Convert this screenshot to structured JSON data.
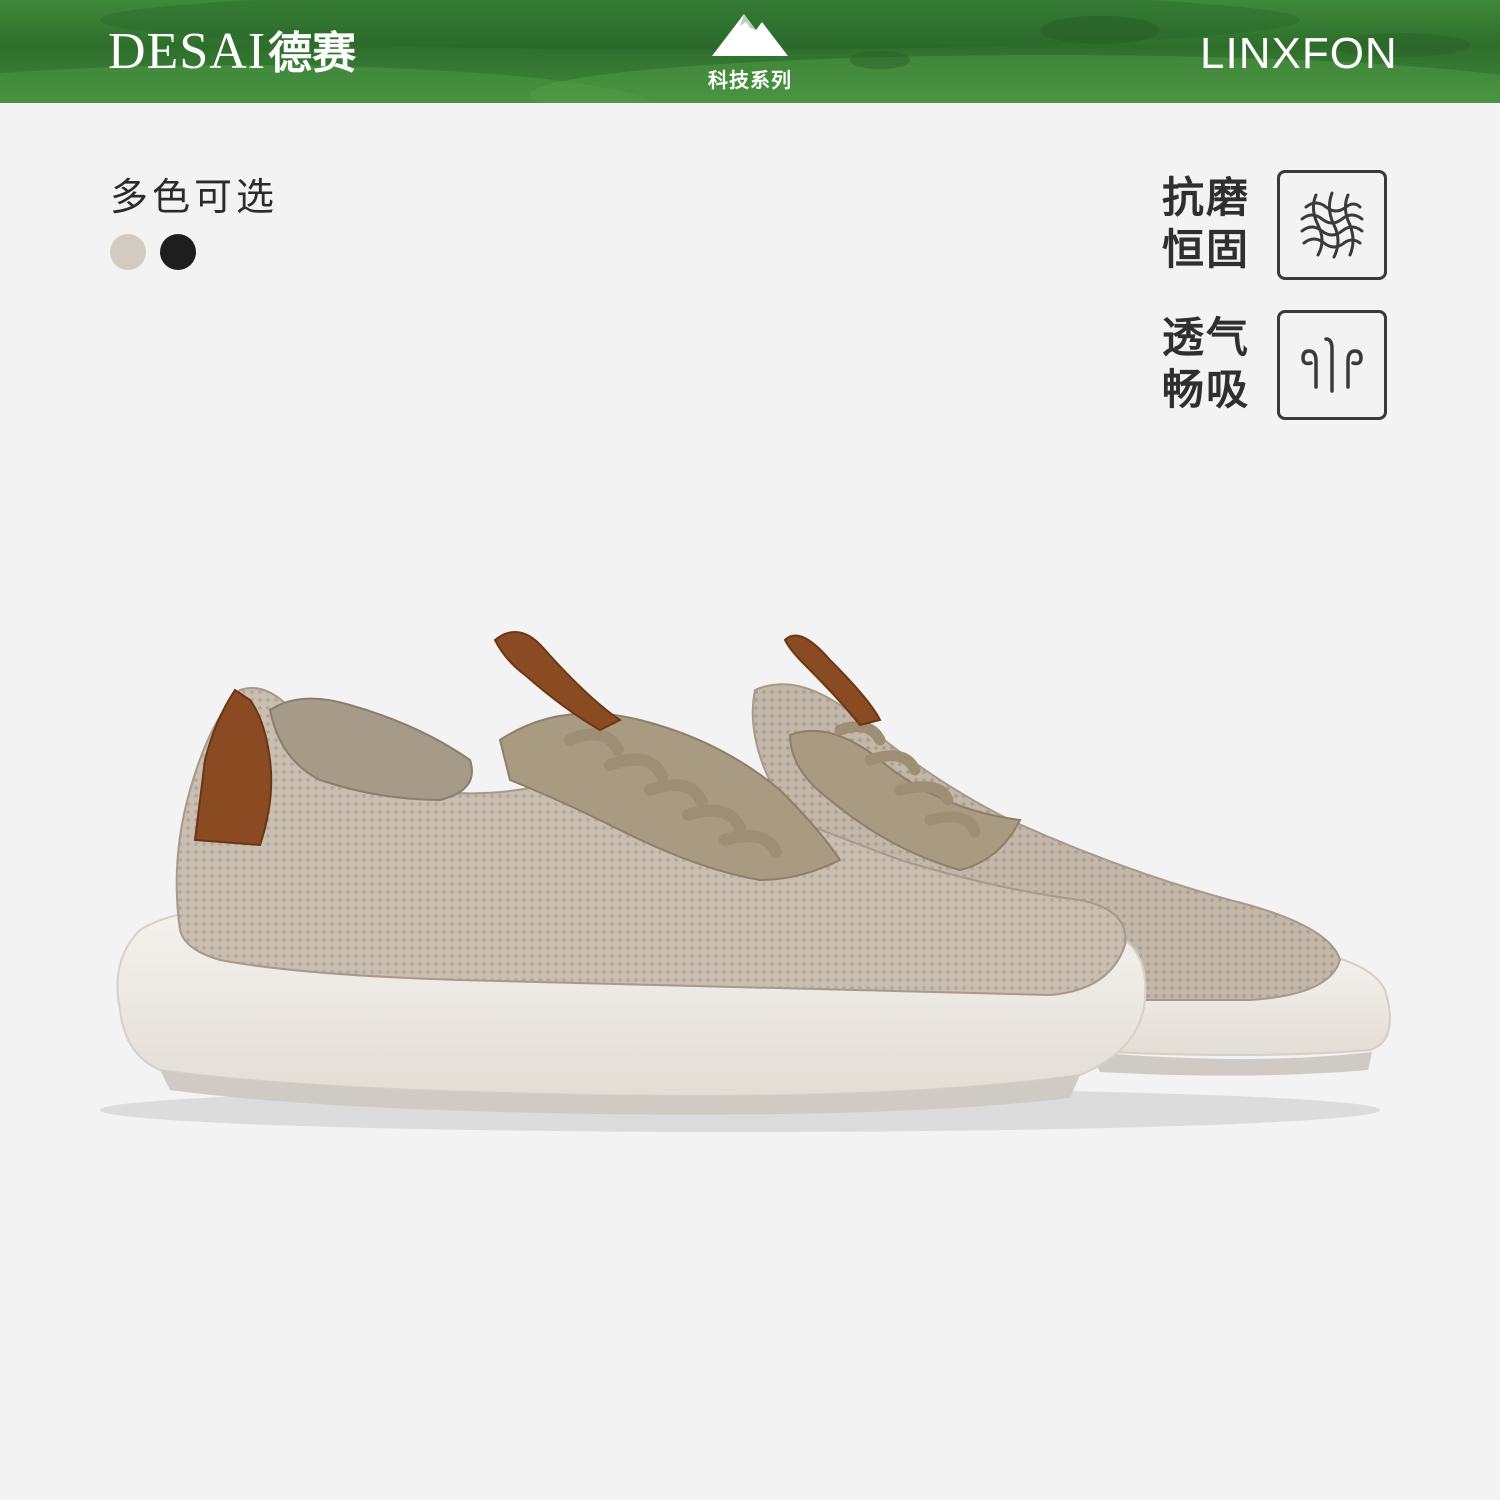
{
  "header": {
    "brand_latin": "DESAI",
    "brand_cn": "德赛",
    "series_label": "科技系列",
    "partner": "LINXFON",
    "mountain_icon": "mountain-icon"
  },
  "colors": {
    "title": "多色可选",
    "options": [
      "#d4cbc0",
      "#1e1e1e"
    ]
  },
  "features": [
    {
      "line1": "抗磨",
      "line2": "恒固",
      "icon": "abrasion-pattern-icon"
    },
    {
      "line1": "透气",
      "line2": "畅吸",
      "icon": "airflow-icon"
    }
  ],
  "palette": {
    "banner_green": "#3a7d35",
    "knit": "#c7bcaf",
    "leather_tab": "#8a4a22",
    "sole": "#efebe5"
  }
}
